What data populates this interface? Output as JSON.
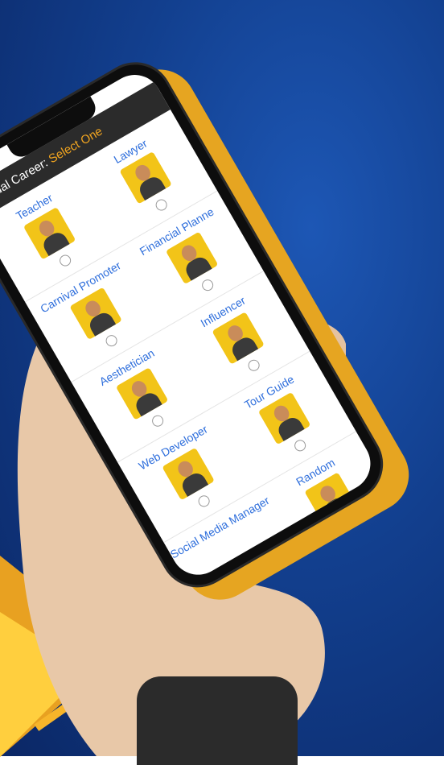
{
  "app": {
    "header_text": "Virtual Career:",
    "header_accent": "Select One"
  },
  "careers": [
    {
      "label": "Teacher"
    },
    {
      "label": "Lawyer"
    },
    {
      "label": "Carnival Promoter"
    },
    {
      "label": "Financial Planne"
    },
    {
      "label": "Aesthetician"
    },
    {
      "label": "Influencer"
    },
    {
      "label": "Web Developer"
    },
    {
      "label": "Tour Guide"
    },
    {
      "label": "Social Media Manager"
    },
    {
      "label": "Random"
    }
  ],
  "colors": {
    "background": "#123f8e",
    "accent": "#f0a420",
    "link": "#2f6fdc",
    "avatar_bg": "#f2c418"
  }
}
